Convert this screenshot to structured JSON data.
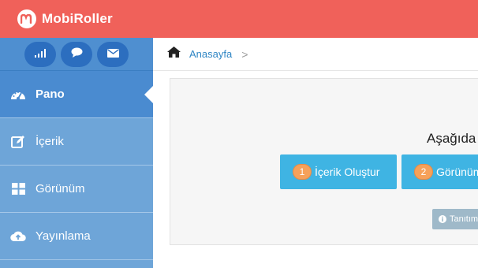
{
  "header": {
    "brand": "MobiRoller"
  },
  "sidebar": {
    "tools": [
      {
        "icon": "signal-icon"
      },
      {
        "icon": "chat-bubble-icon"
      },
      {
        "icon": "envelope-icon"
      }
    ],
    "items": [
      {
        "label": "Pano",
        "icon": "dashboard-icon",
        "active": true
      },
      {
        "label": "İçerik",
        "icon": "edit-icon"
      },
      {
        "label": "Görünüm",
        "icon": "grid-icon"
      },
      {
        "label": "Yayınlama",
        "icon": "cloud-upload-icon"
      }
    ]
  },
  "breadcrumb": {
    "home_label": "Anasayfa",
    "separator": ">"
  },
  "panel": {
    "title": "Aşağıda",
    "steps": [
      {
        "number": "1",
        "label": "İçerik Oluştur"
      },
      {
        "number": "2",
        "label": "Görünüm"
      }
    ],
    "intro_button": "Tanıtım"
  },
  "colors": {
    "header": "#f0615a",
    "sidebar": "#6ea5d8",
    "sidebar_active": "#4a8bd0",
    "step_button": "#3fb4e3",
    "step_number": "#f6a15a"
  }
}
